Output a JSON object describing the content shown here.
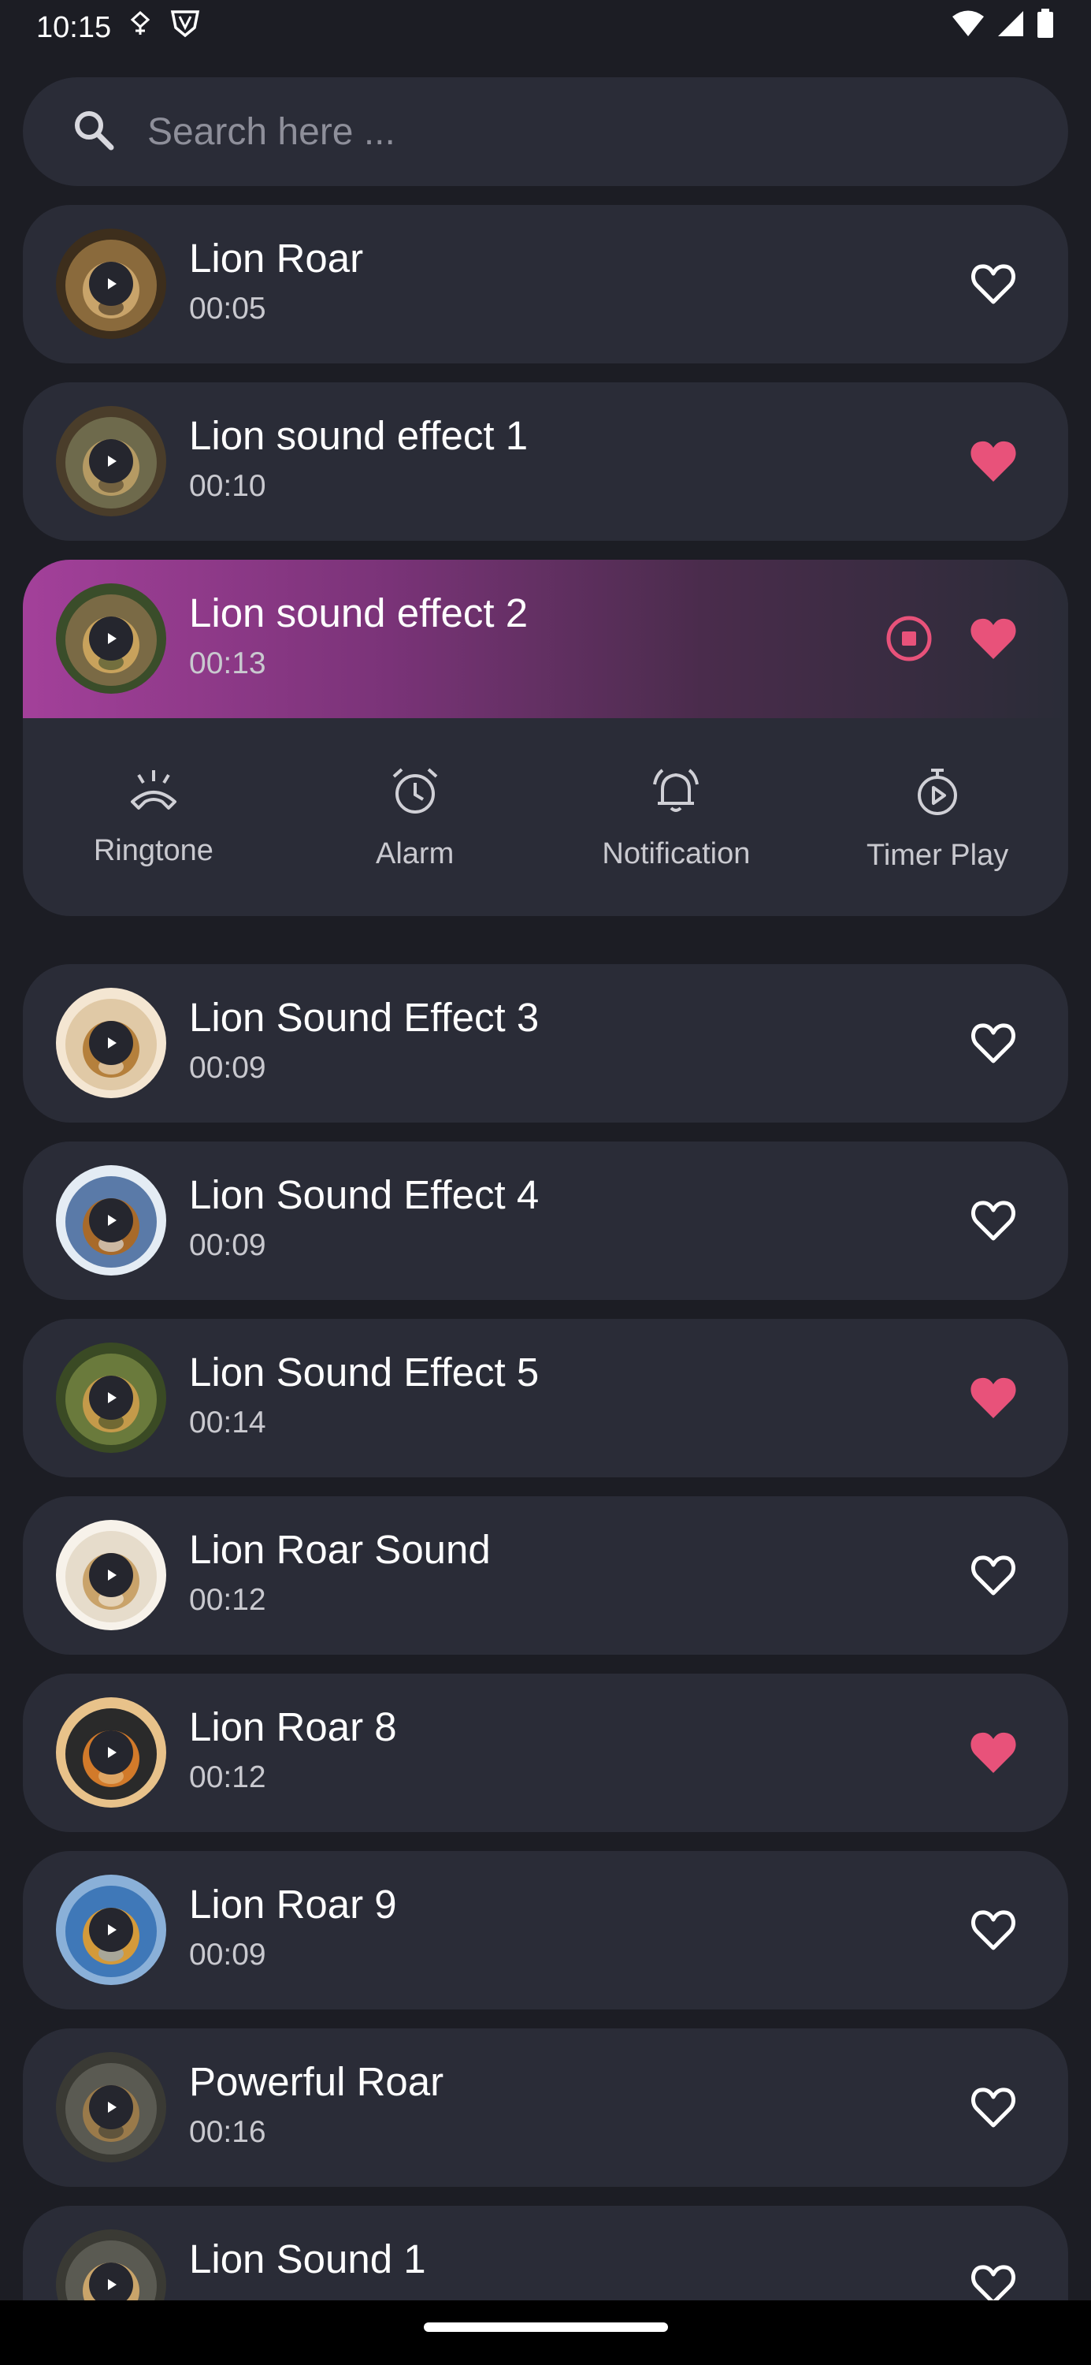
{
  "status_bar": {
    "time": "10:15"
  },
  "search": {
    "placeholder": "Search here ..."
  },
  "sounds": [
    {
      "title": "Lion Roar",
      "duration": "00:05",
      "favorite": false
    },
    {
      "title": "Lion sound effect 1",
      "duration": "00:10",
      "favorite": true
    },
    {
      "title": "Lion sound effect 2",
      "duration": "00:13",
      "favorite": true,
      "playing": true
    },
    {
      "title": "Lion Sound Effect 3",
      "duration": "00:09",
      "favorite": false
    },
    {
      "title": "Lion Sound Effect 4",
      "duration": "00:09",
      "favorite": false
    },
    {
      "title": "Lion Sound Effect 5",
      "duration": "00:14",
      "favorite": true
    },
    {
      "title": "Lion Roar Sound",
      "duration": "00:12",
      "favorite": false
    },
    {
      "title": "Lion Roar 8",
      "duration": "00:12",
      "favorite": true
    },
    {
      "title": "Lion Roar 9",
      "duration": "00:09",
      "favorite": false
    },
    {
      "title": "Powerful Roar",
      "duration": "00:16",
      "favorite": false
    },
    {
      "title": "Lion Sound 1",
      "duration": "",
      "favorite": false
    }
  ],
  "actions": [
    {
      "label": "Ringtone",
      "icon": "phone-ring-icon"
    },
    {
      "label": "Alarm",
      "icon": "alarm-clock-icon"
    },
    {
      "label": "Notification",
      "icon": "bell-ring-icon"
    },
    {
      "label": "Timer Play",
      "icon": "timer-play-icon"
    }
  ],
  "colors": {
    "background": "#1c1d24",
    "card": "#2a2c37",
    "accent_heart": "#e8527a",
    "playing_gradient_start": "#a3409a"
  }
}
